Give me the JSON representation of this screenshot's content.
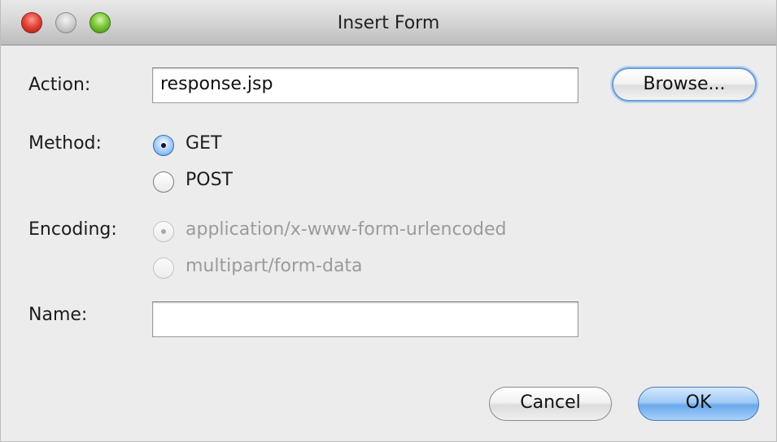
{
  "window": {
    "title": "Insert Form"
  },
  "form": {
    "action": {
      "label": "Action:",
      "value": "response.jsp",
      "browse_label": "Browse..."
    },
    "method": {
      "label": "Method:",
      "options": [
        {
          "label": "GET",
          "selected": true,
          "enabled": true
        },
        {
          "label": "POST",
          "selected": false,
          "enabled": true
        }
      ]
    },
    "encoding": {
      "label": "Encoding:",
      "options": [
        {
          "label": "application/x-www-form-urlencoded",
          "selected": true,
          "enabled": false
        },
        {
          "label": "multipart/form-data",
          "selected": false,
          "enabled": false
        }
      ]
    },
    "name": {
      "label": "Name:",
      "value": ""
    }
  },
  "buttons": {
    "cancel_label": "Cancel",
    "ok_label": "OK"
  },
  "colors": {
    "window_background": "#ececec",
    "default_button": "#6aa8ec",
    "focus_ring": "#6c9bd6",
    "disabled_text": "#9b9b9b"
  }
}
